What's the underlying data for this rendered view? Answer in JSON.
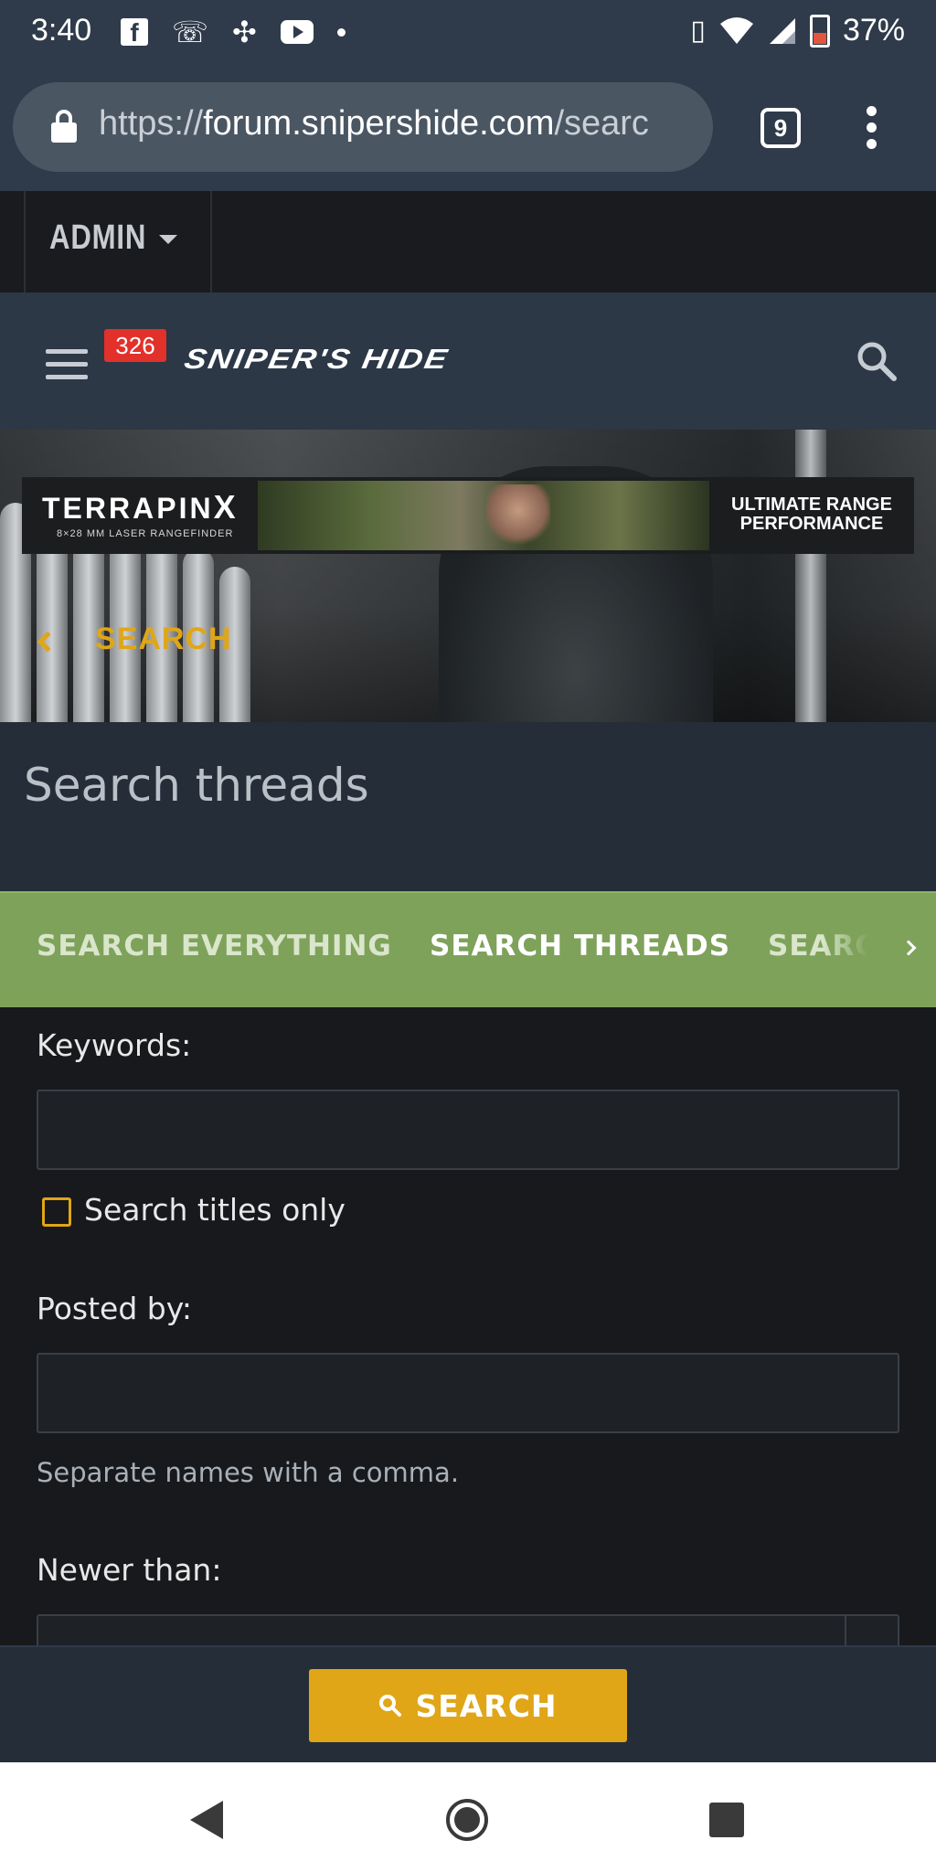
{
  "status_bar": {
    "time": "3:40",
    "battery": "37%",
    "battery_level": 0.37,
    "left_icons": [
      "facebook-icon",
      "missed-call-icon",
      "pinwheel-icon",
      "youtube-icon",
      "dot-icon"
    ],
    "right_icons": [
      "vibrate-icon",
      "wifi-icon",
      "signal-icon",
      "battery-icon"
    ]
  },
  "browser": {
    "url_scheme": "https://",
    "url_host": "forum.snipershide.com",
    "url_path": "/searc",
    "tab_count": "9"
  },
  "admin_bar": {
    "label": "ADMIN"
  },
  "header": {
    "notification_count": "326",
    "logo_text": "SNIPER'S HIDE"
  },
  "banner": {
    "ad_brand": "TERRAPIN",
    "ad_brand_x": "X",
    "ad_subtitle": "8×28 MM LASER RANGEFINDER",
    "ad_tagline_1": "ULTIMATE RANGE",
    "ad_tagline_2": "PERFORMANCE",
    "breadcrumb": "SEARCH"
  },
  "page": {
    "title": "Search threads"
  },
  "tabs": [
    {
      "label": "SEARCH EVERYTHING",
      "active": false
    },
    {
      "label": "SEARCH THREADS",
      "active": true
    },
    {
      "label": "SEARCH",
      "active": false
    }
  ],
  "form": {
    "keywords_label": "Keywords:",
    "keywords_value": "",
    "titles_only_label": "Search titles only",
    "titles_only_checked": false,
    "posted_by_label": "Posted by:",
    "posted_by_value": "",
    "posted_by_hint": "Separate names with a comma.",
    "newer_than_label": "Newer than:"
  },
  "actions": {
    "search_label": "SEARCH"
  },
  "colors": {
    "accent": "#e0a617",
    "tab_green": "#7ea25a",
    "header_bg": "#2c3846",
    "badge_red": "#e2302b"
  }
}
